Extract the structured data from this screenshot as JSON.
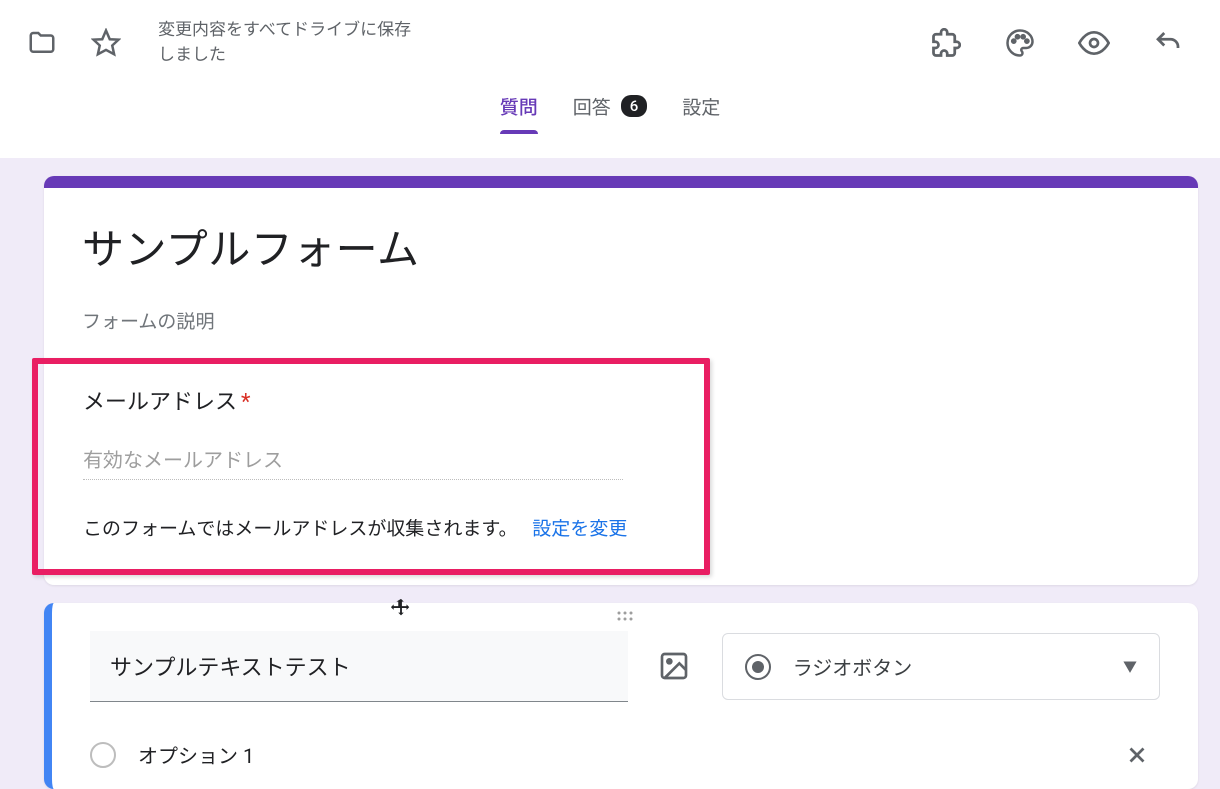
{
  "header": {
    "save_status": "変更内容をすべてドライブに保存しました"
  },
  "tabs": {
    "questions": "質問",
    "responses": "回答",
    "responses_count": "6",
    "settings": "設定"
  },
  "form": {
    "title": "サンプルフォーム",
    "description": "フォームの説明"
  },
  "email": {
    "label": "メールアドレス",
    "placeholder": "有効なメールアドレス",
    "collect_notice": "このフォームではメールアドレスが収集されます。",
    "settings_link": "設定を変更"
  },
  "question": {
    "title": "サンプルテキストテスト",
    "type_label": "ラジオボタン",
    "option1": "オプション 1"
  }
}
